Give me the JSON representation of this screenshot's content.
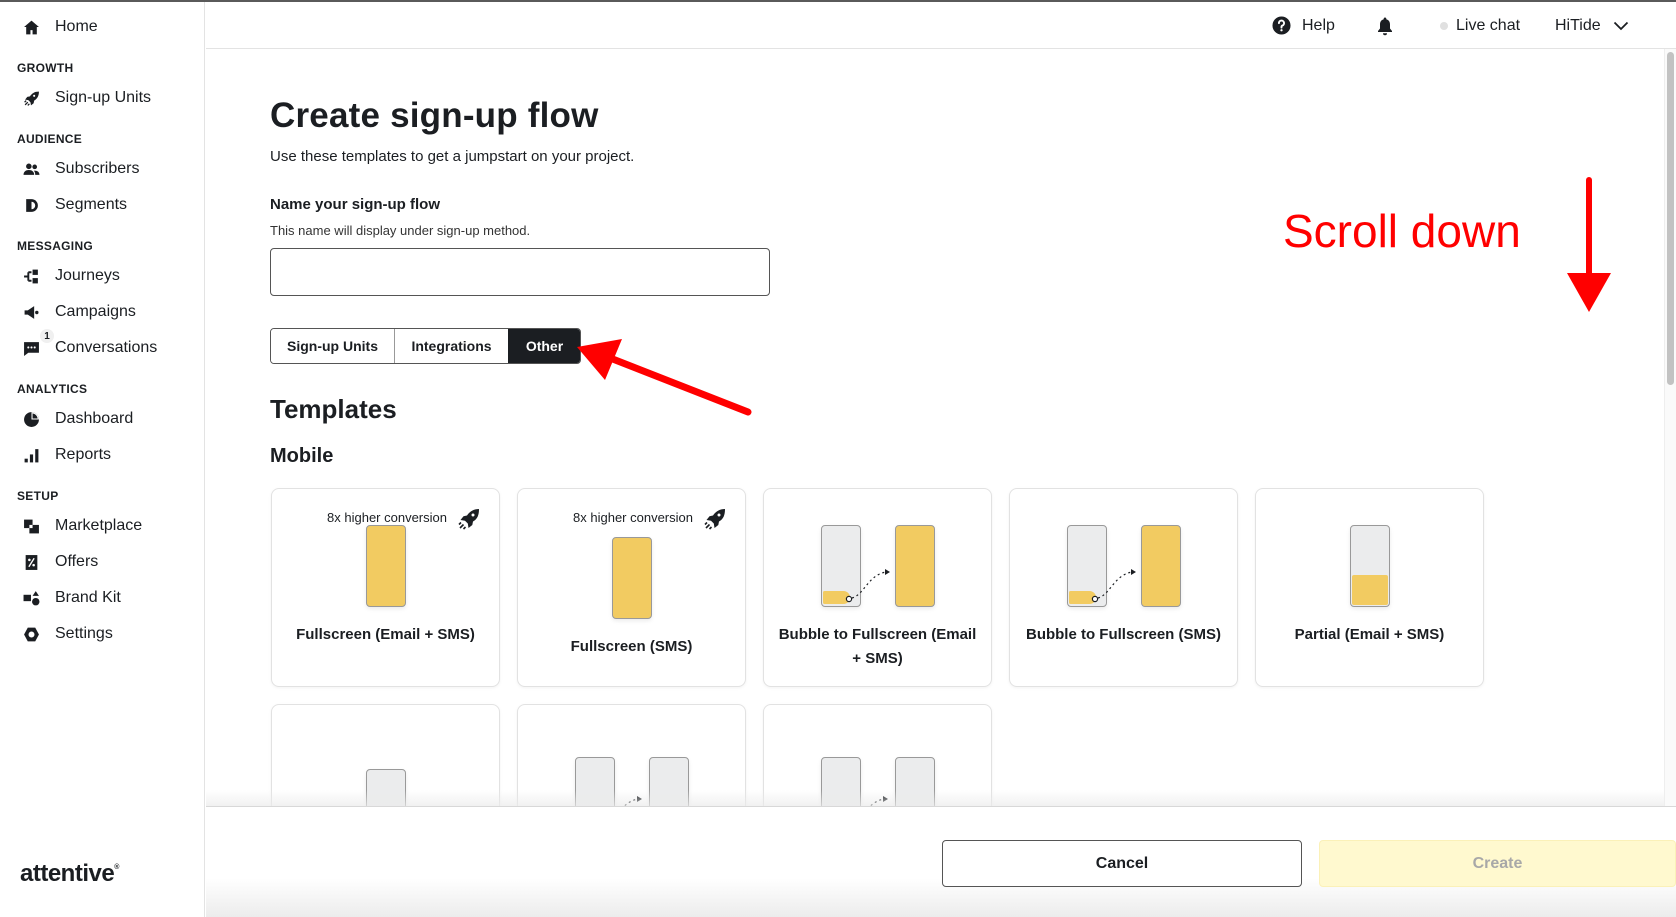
{
  "sidebar": {
    "home": "Home",
    "sections": [
      {
        "title": "GROWTH",
        "items": [
          {
            "label": "Sign-up Units",
            "icon": "rocket-icon"
          }
        ]
      },
      {
        "title": "AUDIENCE",
        "items": [
          {
            "label": "Subscribers",
            "icon": "users-icon"
          },
          {
            "label": "Segments",
            "icon": "segments-icon"
          }
        ]
      },
      {
        "title": "MESSAGING",
        "items": [
          {
            "label": "Journeys",
            "icon": "journeys-icon"
          },
          {
            "label": "Campaigns",
            "icon": "megaphone-icon"
          },
          {
            "label": "Conversations",
            "icon": "chat-icon",
            "badge": "1"
          }
        ]
      },
      {
        "title": "ANALYTICS",
        "items": [
          {
            "label": "Dashboard",
            "icon": "pie-chart-icon"
          },
          {
            "label": "Reports",
            "icon": "bar-chart-icon"
          }
        ]
      },
      {
        "title": "SETUP",
        "items": [
          {
            "label": "Marketplace",
            "icon": "marketplace-icon"
          },
          {
            "label": "Offers",
            "icon": "offers-icon"
          },
          {
            "label": "Brand Kit",
            "icon": "brand-kit-icon"
          },
          {
            "label": "Settings",
            "icon": "settings-icon"
          }
        ]
      }
    ],
    "logo": "attentive"
  },
  "header": {
    "help": "Help",
    "live_chat": "Live chat",
    "account": "HiTide"
  },
  "main": {
    "title": "Create sign-up flow",
    "subtitle": "Use these templates to get a jumpstart on your project.",
    "name_field": {
      "label": "Name your sign-up flow",
      "help": "This name will display under sign-up method.",
      "value": "",
      "placeholder": ""
    },
    "tabs": [
      {
        "label": "Sign-up Units",
        "active": false
      },
      {
        "label": "Integrations",
        "active": false
      },
      {
        "label": "Other",
        "active": true
      }
    ],
    "templates_title": "Templates",
    "mobile_title": "Mobile",
    "templates": [
      {
        "label": "Fullscreen (Email + SMS)",
        "badge": "8x higher conversion",
        "preview": "fullscreen"
      },
      {
        "label": "Fullscreen (SMS)",
        "badge": "8x higher conversion",
        "preview": "fullscreen"
      },
      {
        "label": "Bubble to Fullscreen (Email + SMS)",
        "badge": "",
        "preview": "bubble-to-fullscreen"
      },
      {
        "label": "Bubble to Fullscreen (SMS)",
        "badge": "",
        "preview": "bubble-to-fullscreen"
      },
      {
        "label": "Partial (Email + SMS)",
        "badge": "",
        "preview": "partial"
      },
      {
        "label": "",
        "badge": "",
        "preview": "single-gray"
      },
      {
        "label": "",
        "badge": "",
        "preview": "two-gray"
      },
      {
        "label": "",
        "badge": "",
        "preview": "two-gray"
      }
    ]
  },
  "footer": {
    "cancel": "Cancel",
    "create": "Create"
  },
  "annotations": {
    "scroll_hint": "Scroll down",
    "color": "#ff0000"
  },
  "colors": {
    "accent_yellow": "#f2cb61",
    "dark": "#1b1e22",
    "create_disabled_bg": "#fff9cf"
  }
}
